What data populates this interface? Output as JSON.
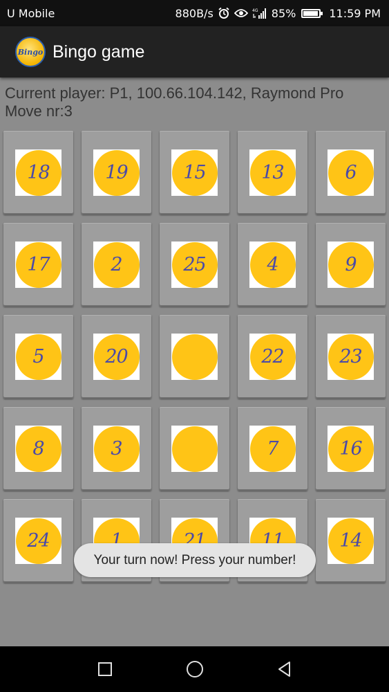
{
  "status_bar": {
    "carrier": "U Mobile",
    "speed": "880B/s",
    "network": "4G",
    "battery": "85%",
    "battery_level": 0.85,
    "time": "11:59 PM"
  },
  "app": {
    "title": "Bingo game",
    "logo_text": "Bingo"
  },
  "info": {
    "current_player": "Current player: P1, 100.66.104.142, Raymond Pro",
    "move": "Move nr:3"
  },
  "grid": {
    "cells": [
      {
        "number": "18"
      },
      {
        "number": "19"
      },
      {
        "number": "15"
      },
      {
        "number": "13"
      },
      {
        "number": "6"
      },
      {
        "number": "17"
      },
      {
        "number": "2"
      },
      {
        "number": "25"
      },
      {
        "number": "4"
      },
      {
        "number": "9"
      },
      {
        "number": "5"
      },
      {
        "number": "20"
      },
      {
        "number": ""
      },
      {
        "number": "22"
      },
      {
        "number": "23"
      },
      {
        "number": "8"
      },
      {
        "number": "3"
      },
      {
        "number": ""
      },
      {
        "number": "7"
      },
      {
        "number": "16"
      },
      {
        "number": "24"
      },
      {
        "number": "1"
      },
      {
        "number": "21"
      },
      {
        "number": "11"
      },
      {
        "number": "14"
      }
    ]
  },
  "toast": {
    "message": "Your turn now! Press your number!"
  },
  "nav": {
    "recent": "recent-apps-icon",
    "home": "home-icon",
    "back": "back-icon"
  },
  "colors": {
    "ball": "#ffc416",
    "number": "#4a4aa8",
    "background": "#8c8c8c"
  }
}
